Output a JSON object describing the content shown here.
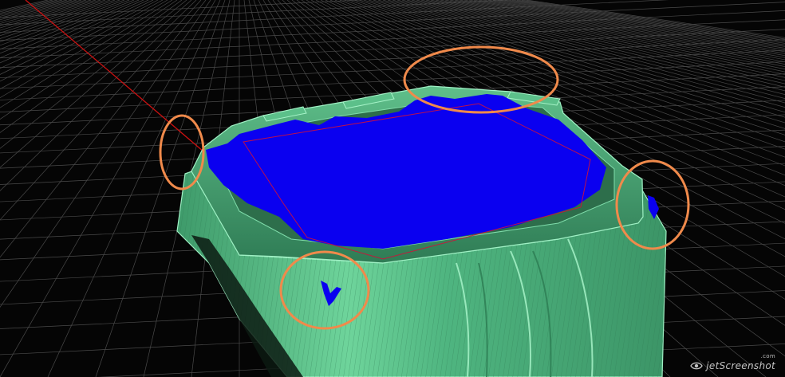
{
  "viewport": {
    "name": "3D model viewport",
    "background_color": "#050505",
    "grid_color": "#4a4a4a",
    "axis_color": "#cc1111",
    "model_color": "#5fc48c",
    "model_rim_color": "#3f8f63",
    "highlight_color": "#0a00f0",
    "annotation_color": "#f08a4b",
    "annotation_count": 4
  },
  "watermark": {
    "text": "jetScreenshot",
    "suffix": ".com",
    "icon": "eye-icon"
  }
}
